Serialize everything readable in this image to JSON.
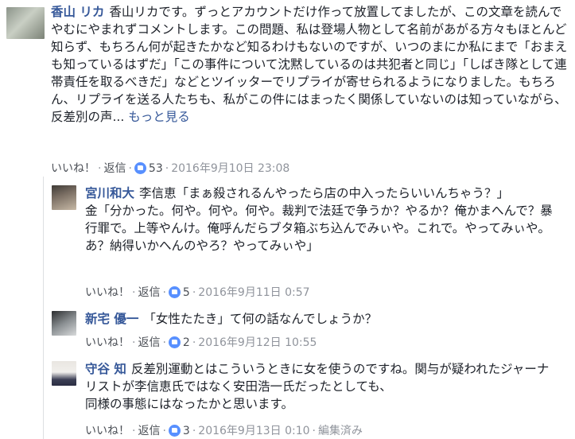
{
  "comments": [
    {
      "author": "香山 リカ",
      "text": "香山リカです。ずっとアカウントだけ作って放置してましたが、この文章を読んでやむにやまれずコメントします。この問題、私は登場人物として名前があがる方々もほとんど知らず、もちろん何が起きたかなど知るわけもないのですが、いつのまにか私にまで「おまえも知っているはずだ」「この事件について沈黙しているのは共犯者と同じ」「しばき隊として連帯責任を取るべきだ」などとツイッターでリプライが寄せられるようになりました。もちろん、リプライを送る人たちも、私がこの件にはまったく関係していないのは知っていながら、反差別の声...",
      "more_link": "もっと見る",
      "like": "いいね！",
      "reply": "返信",
      "count": "53",
      "timestamp": "2016年9月10日 23:08"
    },
    {
      "author": "宮川和大",
      "text": "李信恵「まぁ殺されるんやったら店の中入ったらいいんちゃう？」\n金「分かった。何や。何や。何や。裁判で法廷で争うか？やるか？俺かまへんで？暴行罪で。上等やんけ。俺呼んだらブタ箱ぶち込んでみぃや。これで。やってみぃや。あ？納得いかへんのやろ？やってみぃや」",
      "like": "いいね！",
      "reply": "返信",
      "count": "5",
      "timestamp": "2016年9月11日 0:57"
    },
    {
      "author": "新宅 優一",
      "text": "「女性たたき」て何の話なんでしょうか？",
      "like": "いいね！",
      "reply": "返信",
      "count": "2",
      "timestamp": "2016年9月12日 10:55"
    },
    {
      "author": "守谷 知",
      "text": "反差別運動とはこういうときに女を使うのですね。関与が疑われたジャーナリストが李信恵氏ではなく安田浩一氏だったとしても、\n同様の事態にはなったかと思います。",
      "like": "いいね！",
      "reply": "返信",
      "count": "3",
      "timestamp": "2016年9月13日 0:10",
      "edited": "編集済み"
    }
  ]
}
